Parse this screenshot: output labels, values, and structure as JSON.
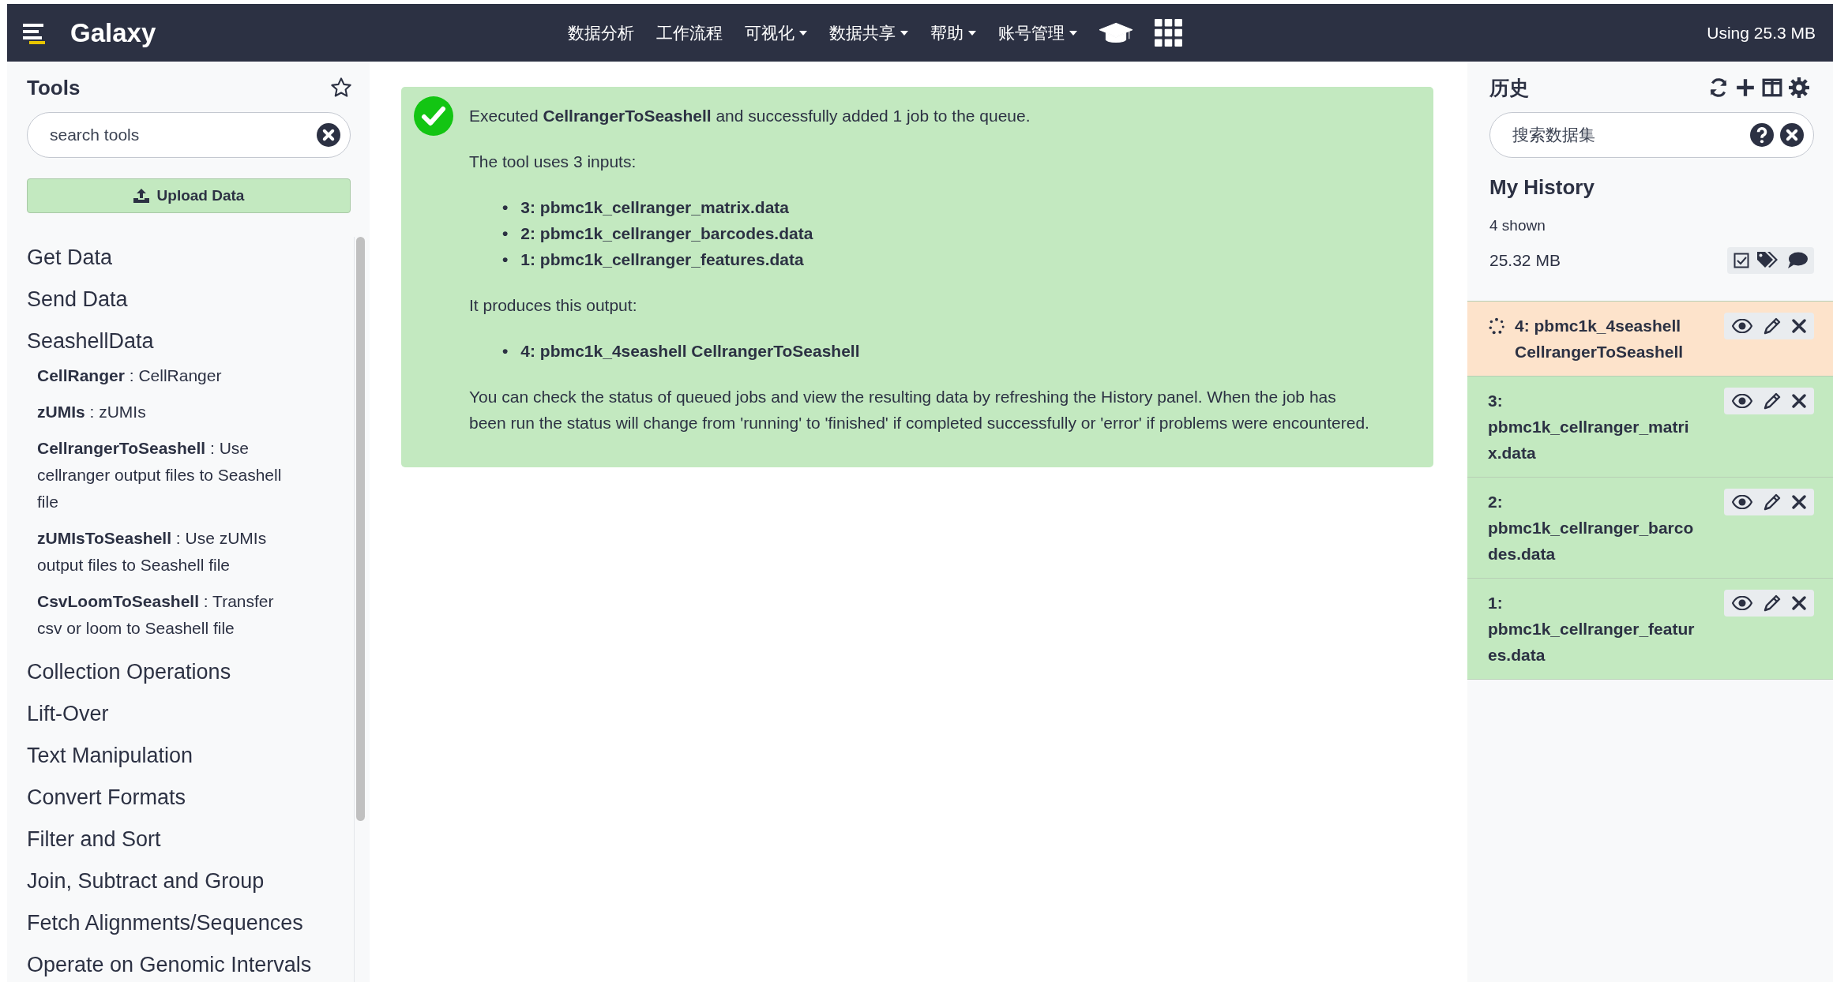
{
  "masthead": {
    "brand": "Galaxy",
    "nav": [
      {
        "label": "数据分析",
        "dropdown": false
      },
      {
        "label": "工作流程",
        "dropdown": false
      },
      {
        "label": "可视化",
        "dropdown": true
      },
      {
        "label": "数据共享",
        "dropdown": true
      },
      {
        "label": "帮助",
        "dropdown": true
      },
      {
        "label": "账号管理",
        "dropdown": true
      }
    ],
    "usage": "Using 25.3 MB"
  },
  "tool_panel": {
    "title": "Tools",
    "search": {
      "placeholder": "search tools"
    },
    "upload_button": "Upload Data",
    "sections": [
      {
        "kind": "section",
        "label": "Get Data"
      },
      {
        "kind": "section",
        "label": "Send Data"
      },
      {
        "kind": "section",
        "label": "SeashellData"
      },
      {
        "kind": "tool",
        "label": "**CellRanger** : CellRanger"
      },
      {
        "kind": "tool",
        "label": "**zUMIs** : zUMIs"
      },
      {
        "kind": "tool",
        "label": "**CellrangerToSeashell** : Use cellranger output files to Seashell file"
      },
      {
        "kind": "tool",
        "label": "**zUMIsToSeashell** : Use zUMIs output files to Seashell file"
      },
      {
        "kind": "tool",
        "label": "**CsvLoomToSeashell** : Transfer csv or loom to Seashell file"
      },
      {
        "kind": "section",
        "label": "Collection Operations"
      },
      {
        "kind": "section",
        "label": "Lift-Over"
      },
      {
        "kind": "section",
        "label": "Text Manipulation"
      },
      {
        "kind": "section",
        "label": "Convert Formats"
      },
      {
        "kind": "section",
        "label": "Filter and Sort"
      },
      {
        "kind": "section",
        "label": "Join, Subtract and Group"
      },
      {
        "kind": "section",
        "label": "Fetch Alignments/Sequences"
      },
      {
        "kind": "section",
        "label": "Operate on Genomic Intervals"
      }
    ]
  },
  "message": {
    "headline": "Executed **CellrangerToSeashell** and successfully added 1 job to the queue.",
    "bullet": "•",
    "inputs_label": "The tool uses 3 inputs:",
    "inputs": [
      "3: pbmc1k_cellranger_matrix.data",
      "2: pbmc1k_cellranger_barcodes.data",
      "1: pbmc1k_cellranger_features.data"
    ],
    "outputs_label": "It produces this output:",
    "outputs": [
      "4: pbmc1k_4seashell CellrangerToSeashell"
    ],
    "note": "You can check the status of queued jobs and view the resulting data by refreshing the History panel. When the job has been run the status will change from 'running' to 'finished' if completed successfully or 'error' if problems were encountered."
  },
  "history_panel": {
    "title": "历史",
    "search": {
      "placeholder": "搜索数据集"
    },
    "name": "My History",
    "shown": "4 shown",
    "size": "25.32 MB",
    "datasets": [
      {
        "title": "4: pbmc1k_4seashell CellrangerToSeashell",
        "running": true
      },
      {
        "title": "3: pbmc1k_cellranger_matrix.data",
        "running": false
      },
      {
        "title": "2: pbmc1k_cellranger_barcodes.data",
        "running": false
      },
      {
        "title": "1: pbmc1k_cellranger_features.data",
        "running": false
      }
    ]
  }
}
